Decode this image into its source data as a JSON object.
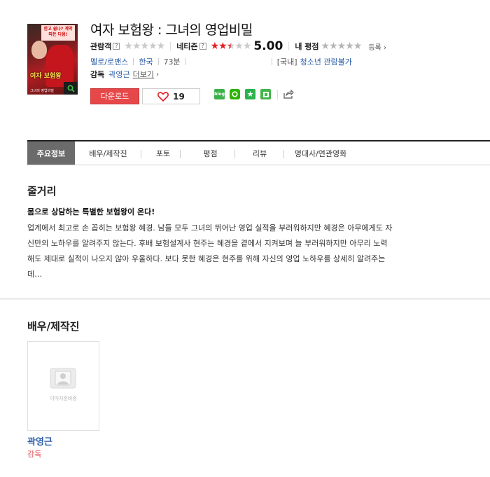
{
  "movie": {
    "title": "여자 보험왕 : 그녀의 영업비밀",
    "poster_top_text": "한고 쉽나? 계약 따든 다음!",
    "poster_title_text": "여자 보험왕",
    "poster_sub_text": "그녀의 영업비밀"
  },
  "ratings": {
    "audience_label": "관람객",
    "audience_help": "?",
    "audience_stars": 0,
    "netizen_label": "네티즌",
    "netizen_help": "?",
    "netizen_stars": 2.5,
    "score": "5.00",
    "my_label": "내 평점",
    "my_stars": 0,
    "register": "등록",
    "register_chevron": "›"
  },
  "meta": {
    "genre": "멜로/로맨스",
    "country": "한국",
    "runtime": "73분",
    "grade_prefix": "[국내]",
    "grade": "청소년 관람불가"
  },
  "director": {
    "label": "감독",
    "name": "곽영근",
    "more": "더보기",
    "more_chevron": "›"
  },
  "actions": {
    "download": "다운로드",
    "like_count": "19"
  },
  "share": {
    "blog_label": "blog"
  },
  "tabs": [
    {
      "label": "주요정보",
      "active": true
    },
    {
      "label": "배우/제작진",
      "active": false
    },
    {
      "label": "포토",
      "active": false
    },
    {
      "label": "평점",
      "active": false
    },
    {
      "label": "리뷰",
      "active": false
    },
    {
      "label": "명대사/연관영화",
      "active": false
    }
  ],
  "synopsis": {
    "section_title": "줄거리",
    "headline": "몸으로 상담하는 특별한 보험왕이 온다!",
    "lines": [
      "업계에서 최고로 손 꼽히는 보험왕 혜경. 남들 모두 그녀의 뛰어난 영업 실적을 부러워하지만 혜경은 아무에게도 자",
      "신만의 노하우를 알려주지 않는다. 후배 보험설계사 현주는 혜경을 곁에서 지켜보며 늘 부러워하지만 아무리 노력",
      "해도 제대로 실적이 나오지 않아 우울하다. 보다 못한 혜경은 현주를 위해 자신의 영업 노하우를 상세히 알려주는",
      "데…"
    ]
  },
  "cast": {
    "section_title": "배우/제작진",
    "items": [
      {
        "name": "곽영근",
        "role": "감독",
        "placeholder": "이미지준비중"
      }
    ]
  },
  "colors": {
    "accent_red": "#e51b24",
    "link_blue": "#2a5ca8",
    "download_bg": "#e6484a",
    "tab_active_bg": "#6b6b6b"
  }
}
